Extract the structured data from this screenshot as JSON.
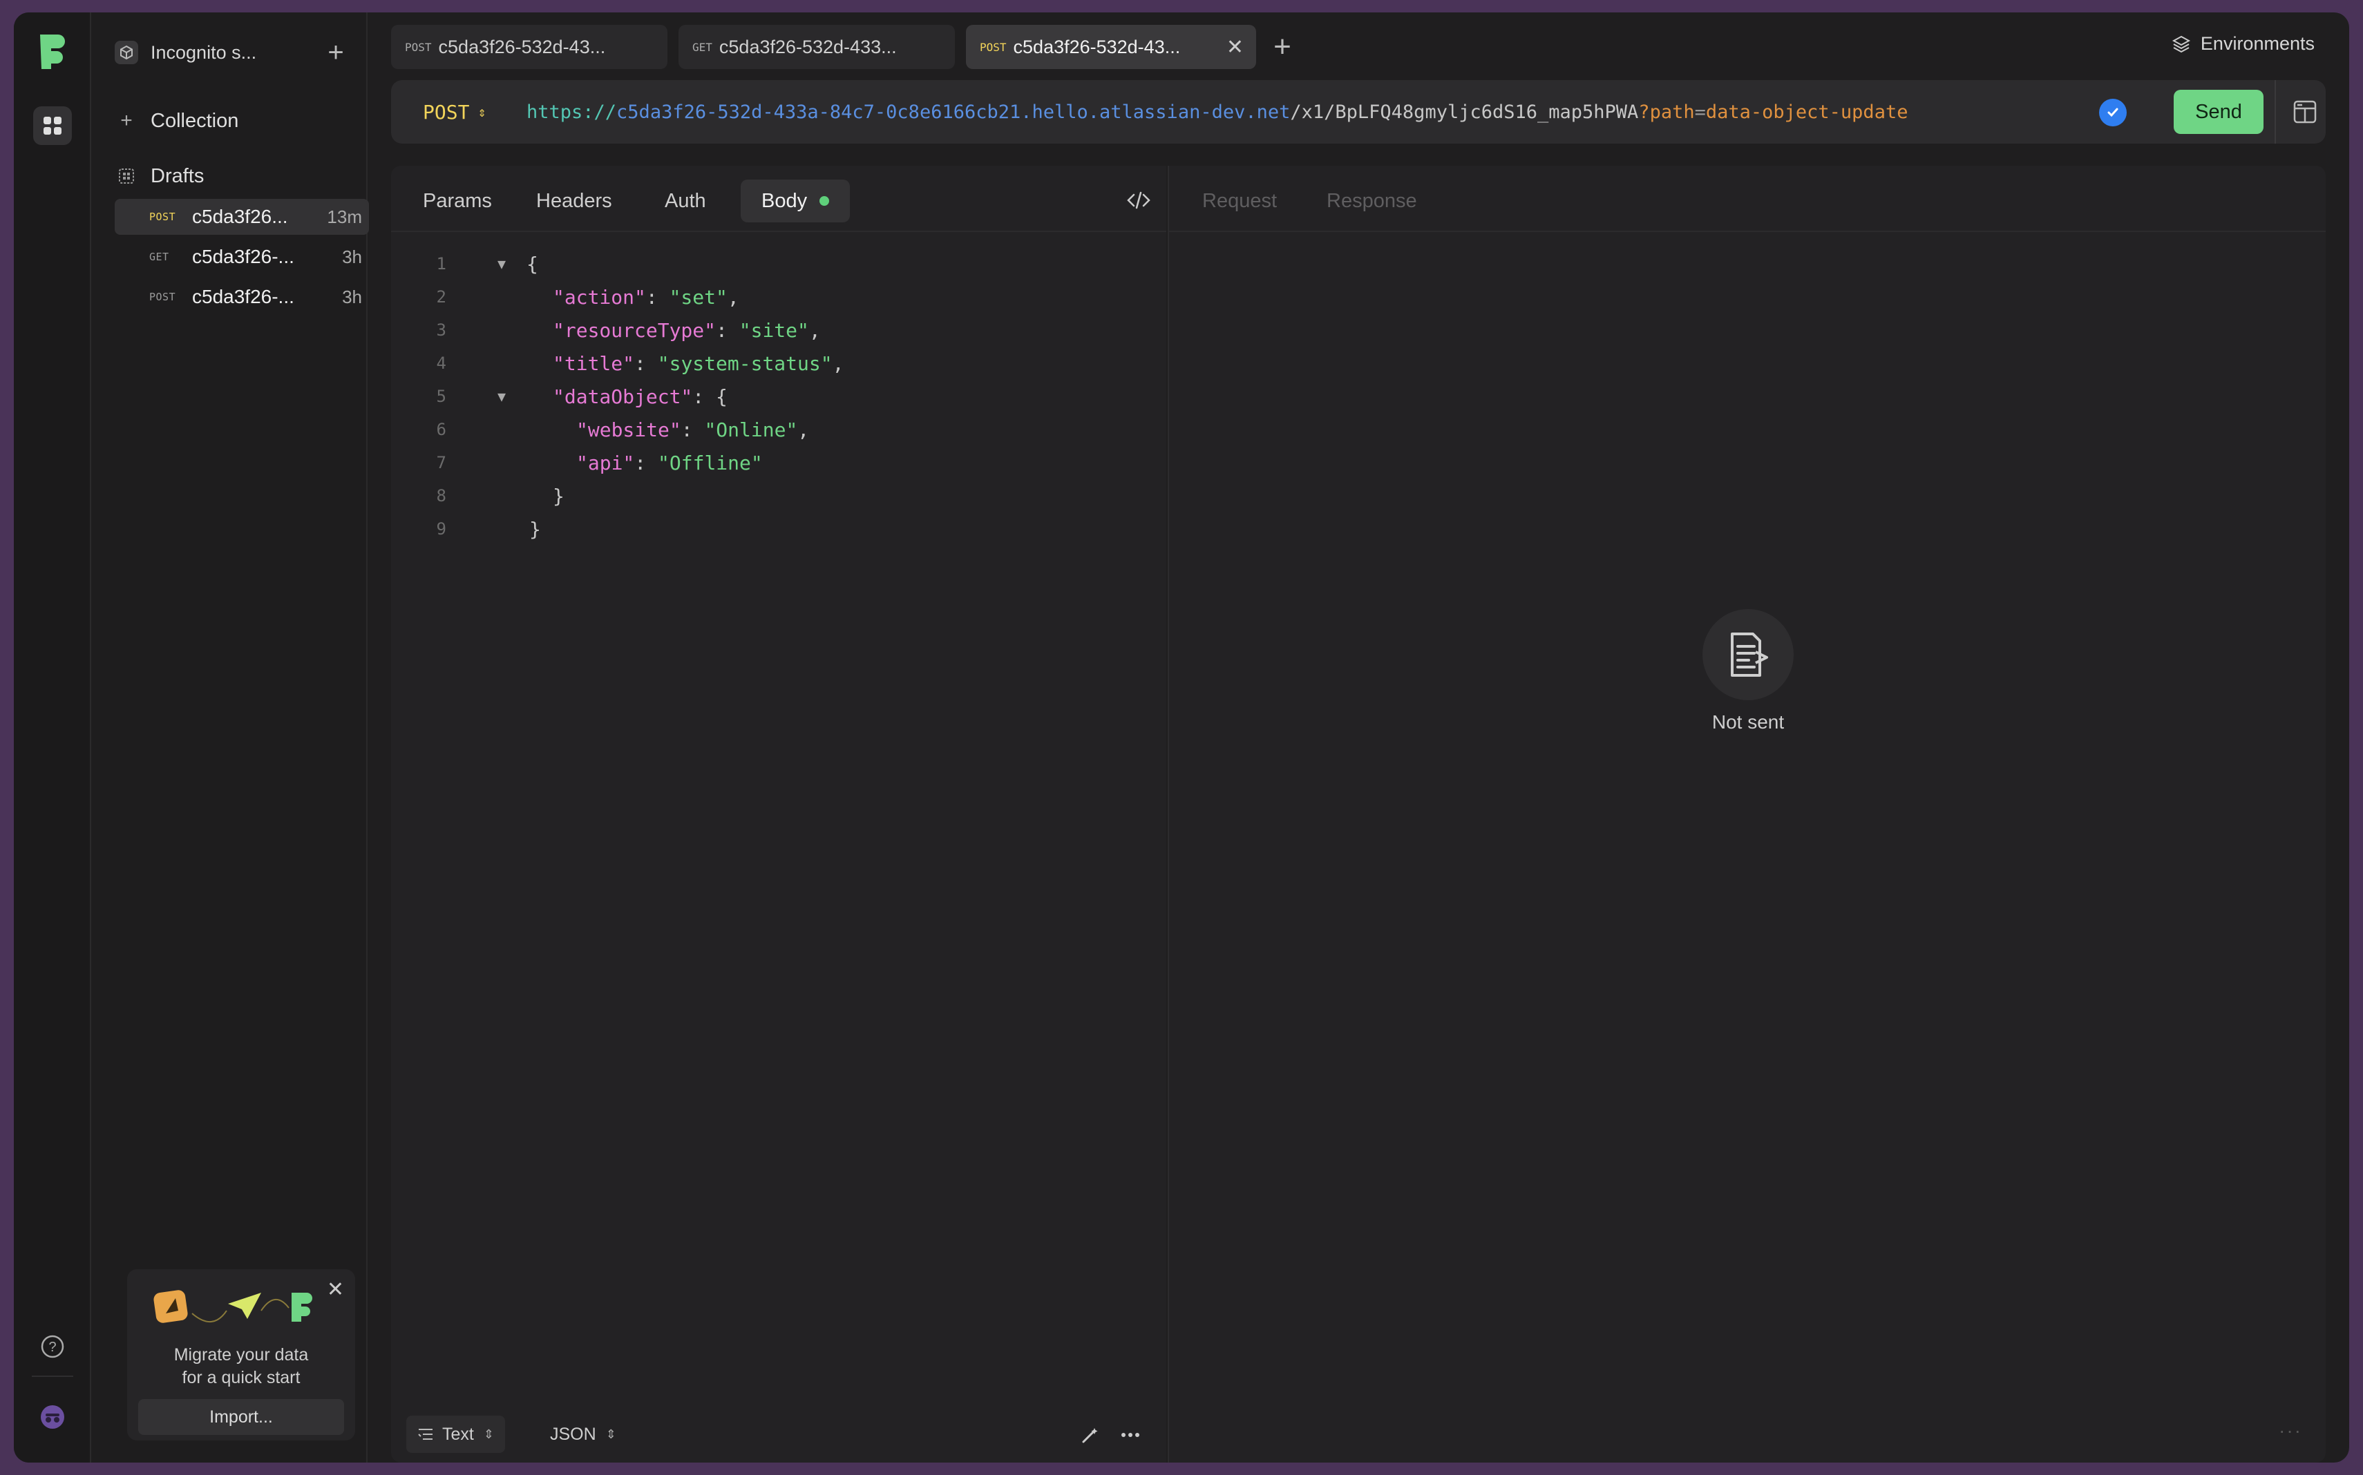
{
  "workspace": {
    "name": "Incognito s..."
  },
  "sidebar": {
    "collection_label": "Collection",
    "drafts_label": "Drafts",
    "drafts": [
      {
        "method": "POST",
        "name": "c5da3f26...",
        "age": "13m"
      },
      {
        "method": "GET",
        "name": "c5da3f26-...",
        "age": "3h"
      },
      {
        "method": "POST",
        "name": "c5da3f26-...",
        "age": "3h"
      }
    ]
  },
  "promo": {
    "text_line1": "Migrate your data",
    "text_line2": "for a quick start",
    "button": "Import..."
  },
  "tabs": [
    {
      "method": "POST",
      "title": "c5da3f26-532d-43..."
    },
    {
      "method": "GET",
      "title": "c5da3f26-532d-433..."
    },
    {
      "method": "POST",
      "title": "c5da3f26-532d-43..."
    }
  ],
  "environments_label": "Environments",
  "request": {
    "method": "POST",
    "url": {
      "scheme": "https://",
      "host": "c5da3f26-532d-433a-84c7-0c8e6166cb21.hello.atlassian-dev.net",
      "path": "/x1/BpLFQ48gmyljc6dS16_map5hPWA",
      "query_mark": "?",
      "query_key": "path",
      "query_eq": "=",
      "query_value": "data-object-update"
    },
    "send_label": "Send",
    "tabs": {
      "params": "Params",
      "headers": "Headers",
      "auth": "Auth",
      "body": "Body"
    },
    "body_lines": [
      {
        "n": "1",
        "text": "{"
      },
      {
        "n": "2",
        "key": "\"action\"",
        "value": "\"set\""
      },
      {
        "n": "3",
        "key": "\"resourceType\"",
        "value": "\"site\""
      },
      {
        "n": "4",
        "key": "\"title\"",
        "value": "\"system-status\""
      },
      {
        "n": "5",
        "key": "\"dataObject\"",
        "open": "{"
      },
      {
        "n": "6",
        "key": "\"website\"",
        "value": "\"Online\""
      },
      {
        "n": "7",
        "key": "\"api\"",
        "value": "\"Offline\""
      },
      {
        "n": "8",
        "text": "}"
      },
      {
        "n": "9",
        "text": "}"
      }
    ],
    "footer": {
      "mode": "Text",
      "format": "JSON"
    }
  },
  "response": {
    "tabs": {
      "request": "Request",
      "response": "Response"
    },
    "empty_text": "Not sent"
  },
  "colors": {
    "accent_green": "#6fd585",
    "method_post": "#f2d45a",
    "check_blue": "#2f7ef0"
  }
}
